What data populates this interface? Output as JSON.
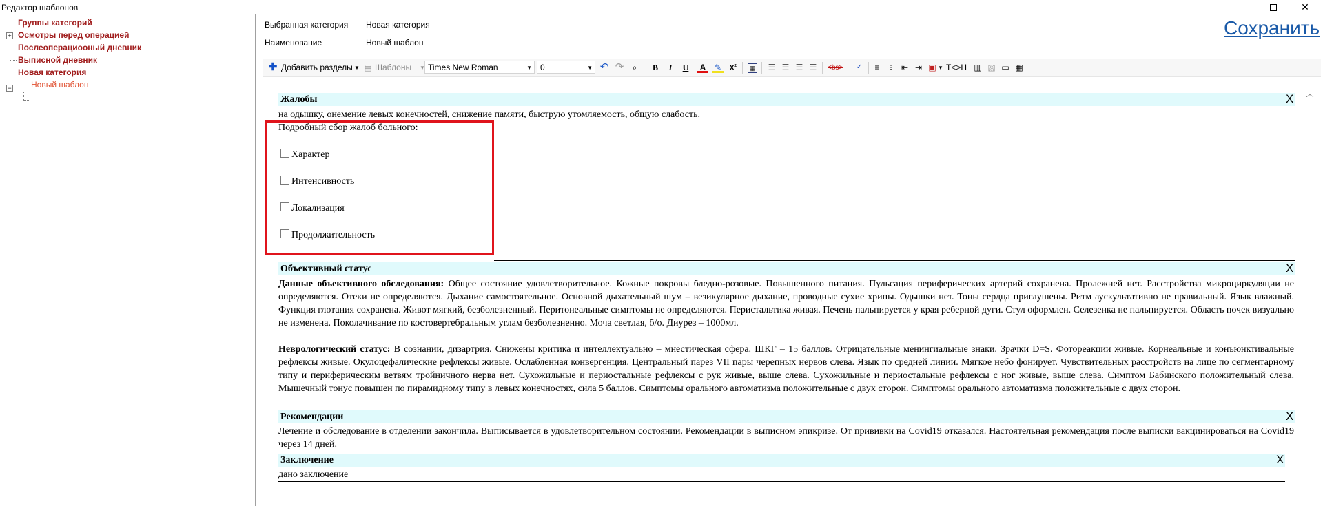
{
  "window": {
    "title": "Редактор шаблонов",
    "minimize_glyph": "—",
    "close_glyph": "✕"
  },
  "tree": {
    "items": [
      {
        "label": "Группы категорий"
      },
      {
        "label": "Осмотры перед операцией",
        "expander": "+"
      },
      {
        "label": "Послеоперациооный дневник"
      },
      {
        "label": "Выписной дневник"
      },
      {
        "label": "Новая категория",
        "expander": "−"
      },
      {
        "label": "Новый шаблон"
      }
    ]
  },
  "header": {
    "selected_category_label": "Выбранная категория",
    "selected_category_value": "Новая категория",
    "name_label": "Наименование",
    "name_value": "Новый шаблон",
    "save_label": "Сохранить"
  },
  "toolbar": {
    "add_sections_label": "Добавить разделы",
    "templates_label": "Шаблоны",
    "font_family": "Times New Roman",
    "font_size": "0",
    "html_toggle_label": "T<>H",
    "icons": [
      "plus-icon",
      "templates-icon",
      "undo-icon",
      "redo-icon",
      "find-icon",
      "bold-icon",
      "italic-icon",
      "underline-icon",
      "font-color-icon",
      "highlight-icon",
      "superscript-icon",
      "image-icon",
      "align-left-icon",
      "align-center-icon",
      "align-right-icon",
      "align-justify-icon",
      "strikethrough-icon",
      "spellcheck-icon",
      "ordered-list-icon",
      "unordered-list-icon",
      "outdent-icon",
      "indent-icon",
      "table-props-icon",
      "html-toggle-icon",
      "paste-icon",
      "clipboard-icon",
      "field-icon",
      "table-icon"
    ],
    "bold_glyph": "B",
    "italic_glyph": "I",
    "underline_glyph": "U",
    "font_color_glyph": "A",
    "superscript_glyph": "x²",
    "strike_glyph": "<bs>"
  },
  "sections": {
    "complaints": {
      "title": "Жалобы",
      "text": "на одышку, онемение левых конечностей, снижение памяти, быструю утомляемость, общую слабость.",
      "sub_heading": "Подробный сбор жалоб больного:",
      "checkboxes": [
        "Характер",
        "Интенсивность",
        "Локализация",
        "Продолжительность"
      ]
    },
    "objective": {
      "title": "Объективный статус",
      "p1_bold": "Данные объективного обследования:",
      "p1_text": " Общее состояние удовлетворительное. Кожные покровы бледно-розовые. Повышенного питания. Пульсация периферических артерий сохранена. Пролежней нет. Расстройства микроциркуляции не определяются. Отеки не определяются. Дыхание самостоятельное. Основной дыхательный шум – везикулярное дыхание, проводные сухие хрипы. Одышки нет. Тоны сердца приглушены. Ритм аускультативно не правильный. Язык влажный. Функция глотания сохранена. Живот мягкий, безболезненный. Перитонеальные симптомы не определяются. Перистальтика живая. Печень пальпируется у края реберной дуги. Стул оформлен. Селезенка не пальпируется. Область почек визуально не изменена. Поколачивание по костовертебральным углам безболезненно. Моча светлая, б/о. Диурез – 1000мл.",
      "p2_bold": "Неврологический статус:",
      "p2_text": " В сознании, дизартрия. Снижены критика и интеллектуально – мнестическая сфера. ШКГ – 15 баллов. Отрицательные менингиальные знаки. Зрачки D=S. Фотореакции живые. Корнеальные и конъюнктивальные рефлексы живые. Окулоцефалические рефлексы живые. Ослабленная конвергенция. Центральный парез VII пары черепных нервов слева. Язык по средней линии. Мягкое небо фонирует. Чувствительных расстройств на лице по сегментарному типу и периферическим ветвям тройничного нерва нет. Сухожильные и периостальные рефлексы с рук живые, выше слева. Сухожильные и периостальные рефлексы с ног живые, выше слева. Симптом Бабинского положительный слева. Мышечный тонус повышен по пирамидному типу в левых конечностях, сила 5 баллов. Симптомы орального автоматизма положительные с двух сторон. Симптомы орального автоматизма положительные с двух сторон."
    },
    "recommendations": {
      "title": "Рекомендации",
      "text": "Лечение и обследование в отделении закончила. Выписывается в удовлетворительном  состоянии. Рекомендации в выписном эпикризе. От прививки  на Covid19 отказался. Настоятельная рекомендация после выписки вакцинироваться на Covid19 через 14 дней."
    },
    "conclusion": {
      "title": "Заключение",
      "text": "дано заключение"
    },
    "close_glyph": "X"
  },
  "colors": {
    "tree_text": "#a01c1c",
    "tree_selected": "#e05030",
    "section_header_bg": "#e0fafc",
    "save_link": "#1a5aa8",
    "highlight_border": "#e0141c"
  }
}
